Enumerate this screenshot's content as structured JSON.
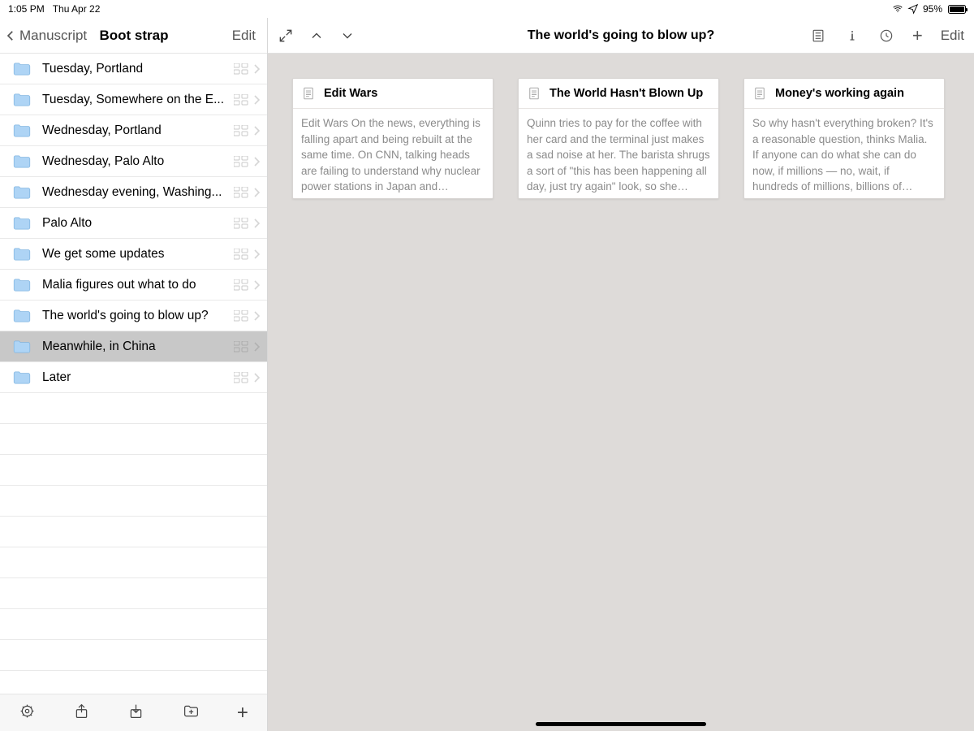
{
  "statusbar": {
    "time": "1:05 PM",
    "date": "Thu Apr 22",
    "battery": "95%"
  },
  "sidebar": {
    "back_label": "Manuscript",
    "title": "Boot strap",
    "edit_label": "Edit",
    "items": [
      {
        "label": "Tuesday, Portland"
      },
      {
        "label": "Tuesday, Somewhere on the E..."
      },
      {
        "label": "Wednesday, Portland"
      },
      {
        "label": "Wednesday, Palo Alto"
      },
      {
        "label": "Wednesday evening, Washing..."
      },
      {
        "label": "Palo Alto"
      },
      {
        "label": "We get some updates"
      },
      {
        "label": "Malia figures out what to do"
      },
      {
        "label": "The world's going to blow up?"
      },
      {
        "label": "Meanwhile, in China",
        "selected": true
      },
      {
        "label": "Later"
      }
    ]
  },
  "main": {
    "title": "The world's going to blow up?",
    "edit_label": "Edit",
    "cards": [
      {
        "title": "Edit Wars",
        "body": "Edit Wars On the news, everything is falling apart and being rebuilt at the same time. On CNN, talking heads are failing to understand why nuclear power stations in Japan and Germany aren't exploding.  xxxx on Fox News i…"
      },
      {
        "title": "The World Hasn't Blown Up",
        "body": "Quinn tries to pay for the coffee with her card and the terminal just makes a sad noise at her. The barista shrugs a sort of \"this has been happening all day, just try again\" look, so she inserts the chip card again and the transacti…"
      },
      {
        "title": "Money's working again",
        "body": "So why hasn't everything broken? It's a reasonable question, thinks Malia. If anyone can do what she can do now, if millions — no, wait, if hundreds of millions, billions of people - can do what she can do, then why hasn't ev…"
      }
    ]
  }
}
